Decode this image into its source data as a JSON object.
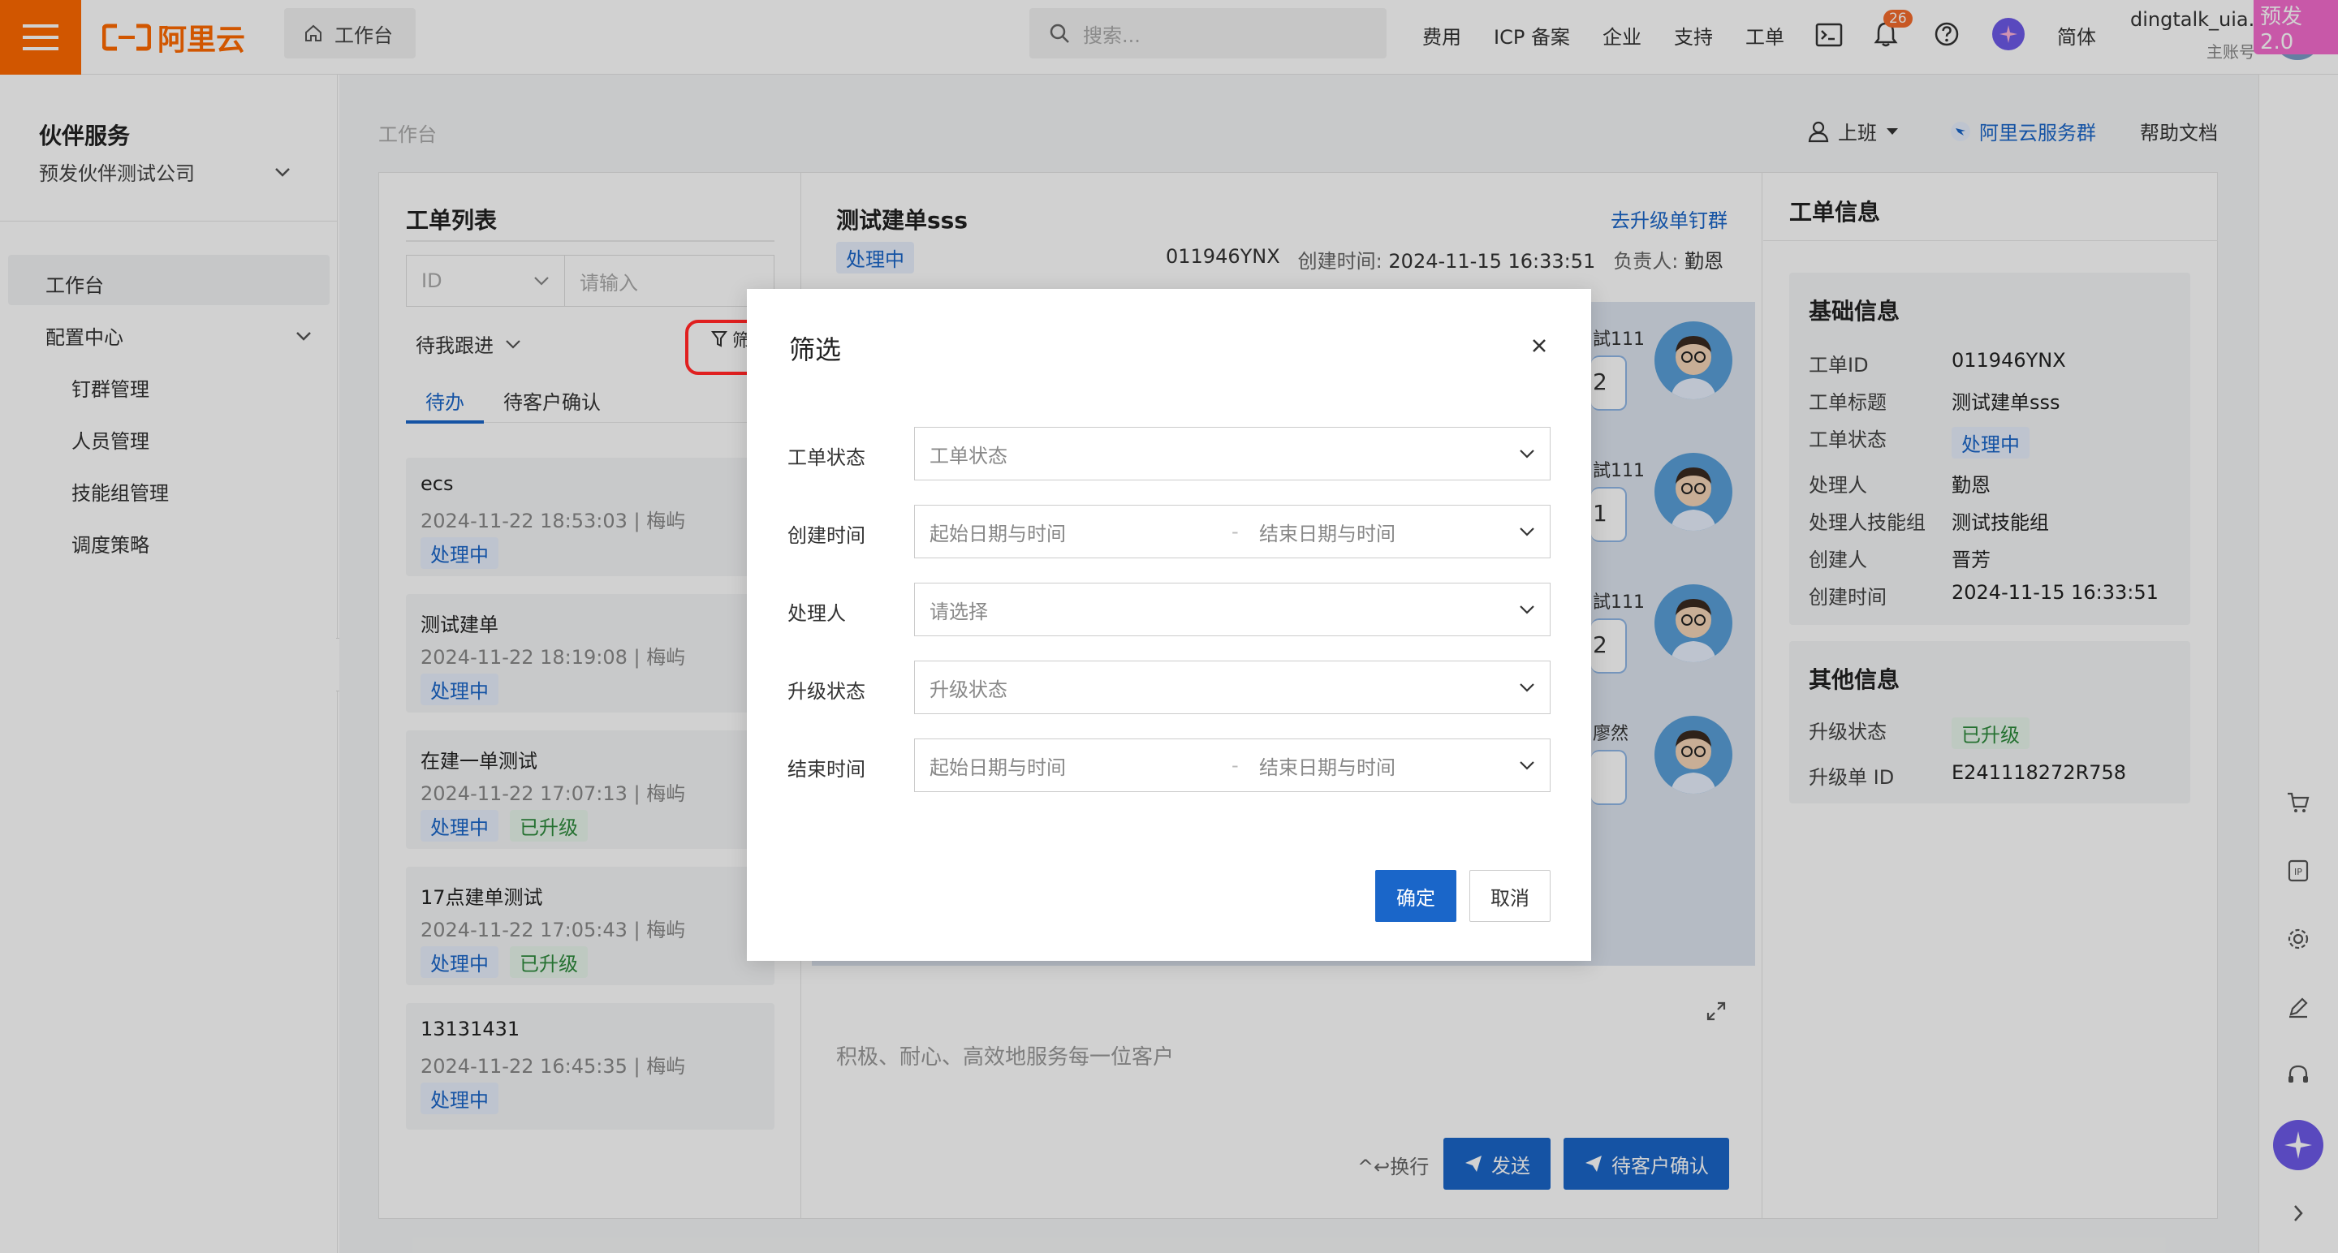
{
  "topbar": {
    "logo_text": "阿里云",
    "workbench_tab": "工作台",
    "search_placeholder": "搜索...",
    "nav": [
      "费用",
      "ICP 备案",
      "企业",
      "支持",
      "工单"
    ],
    "bell_count": "26",
    "language": "简体",
    "user_name": "dingtalk_uia...",
    "user_sub": "主账号",
    "env_tag": "预发2.0"
  },
  "sidebar": {
    "title": "伙伴服务",
    "company": "预发伙伴测试公司",
    "items": {
      "workbench": "工作台",
      "config_center": "配置中心",
      "dingding_groups": "钉群管理",
      "staff": "人员管理",
      "skill_groups": "技能组管理",
      "dispatch": "调度策略"
    }
  },
  "header": {
    "breadcrumb": "工作台",
    "shift": "上班",
    "dt_group": "阿里云服务群",
    "help_doc": "帮助文档"
  },
  "ticket_list": {
    "title": "工单列表",
    "id_select": "ID",
    "input_placeholder": "请输入",
    "follow_filter": "待我跟进",
    "filter_label": "筛",
    "tabs": [
      "待办",
      "待客户确认"
    ],
    "cards": [
      {
        "title": "ecs",
        "time": "2024-11-22 18:53:03",
        "owner": "梅屿",
        "status": "处理中",
        "upgrade": ""
      },
      {
        "title": "测试建单",
        "time": "2024-11-22 18:19:08",
        "owner": "梅屿",
        "status": "处理中",
        "upgrade": ""
      },
      {
        "title": "在建一单测试",
        "time": "2024-11-22 17:07:13",
        "owner": "梅屿",
        "status": "处理中",
        "upgrade": "已升级"
      },
      {
        "title": "17点建单测试",
        "time": "2024-11-22 17:05:43",
        "owner": "梅屿",
        "status": "处理中",
        "upgrade": "已升级"
      },
      {
        "title": "13131431",
        "time": "2024-11-22 16:45:35",
        "owner": "梅屿",
        "status": "处理中",
        "upgrade": ""
      }
    ]
  },
  "ticket": {
    "title": "测试建单sss",
    "upgrade_link": "去升级单钉群",
    "status": "处理中",
    "id": "011946YNX",
    "created_label": "创建时间:",
    "created": "2024-11-15 16:33:51",
    "owner_label": "负责人:",
    "owner": "勤恩",
    "chat_fragments": [
      "試111",
      "2",
      "試111",
      "1",
      "試111",
      "2",
      "廖然"
    ],
    "slogan": "积极、耐心、高效地服务每一位客户",
    "newline_hint": "^↩换行",
    "send": "发送",
    "wait_confirm": "待客户确认"
  },
  "info": {
    "title": "工单信息",
    "basic_title": "基础信息",
    "basic": [
      {
        "k": "工单ID",
        "v": "011946YNX"
      },
      {
        "k": "工单标题",
        "v": "测试建单sss"
      },
      {
        "k": "工单状态",
        "v": "处理中"
      },
      {
        "k": "处理人",
        "v": "勤恩"
      },
      {
        "k": "处理人技能组",
        "v": "测试技能组"
      },
      {
        "k": "创建人",
        "v": "晋芳"
      },
      {
        "k": "创建时间",
        "v": "2024-11-15 16:33:51"
      }
    ],
    "other_title": "其他信息",
    "other": [
      {
        "k": "升级状态",
        "v": "已升级"
      },
      {
        "k": "升级单 ID",
        "v": "E241118272R758"
      }
    ]
  },
  "dialog": {
    "title": "筛选",
    "fields": [
      {
        "label": "工单状态",
        "placeholder": "工单状态",
        "end": ""
      },
      {
        "label": "创建时间",
        "placeholder": "起始日期与时间",
        "end": "结束日期与时间"
      },
      {
        "label": "处理人",
        "placeholder": "请选择",
        "end": ""
      },
      {
        "label": "升级状态",
        "placeholder": "升级状态",
        "end": ""
      },
      {
        "label": "结束时间",
        "placeholder": "起始日期与时间",
        "end": "结束日期与时间"
      }
    ],
    "range_sep": "-",
    "ok": "确定",
    "cancel": "取消"
  },
  "colors": {
    "brand": "#ff6a00",
    "primary": "#1a66c9",
    "highlight": "#e02020"
  }
}
